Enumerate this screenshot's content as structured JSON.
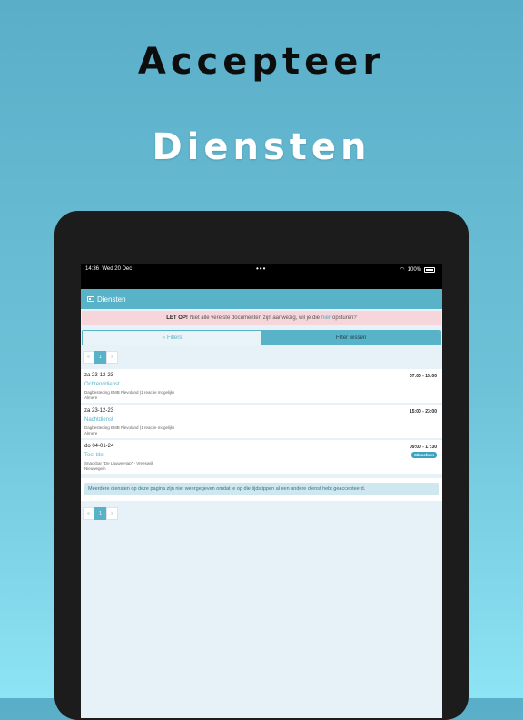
{
  "hero": {
    "line1": "Accepteer",
    "line2": "Diensten"
  },
  "status_bar": {
    "time": "14:36",
    "date": "Wed 20 Dec",
    "dots": "•••",
    "battery": "100%"
  },
  "nav": {
    "title": "Diensten",
    "icon": "id-card-icon"
  },
  "alert": {
    "strong": "LET OP!",
    "text": "Niet alle vereiste documenten zijn aanwezig, wil je die",
    "link": "hier",
    "suffix": "opsturen?"
  },
  "filters": {
    "filter_label": "Filters",
    "filter_icon": "double-chevron-down-icon",
    "clear_label": "Filter wissen"
  },
  "pagination": {
    "prev": "«",
    "page": "1",
    "next": "»"
  },
  "shifts": [
    {
      "date": "za 23-12-23",
      "time": "07:00 - 15:00",
      "title": "Ochtenddienst",
      "org": "Dagbesteding EMB Flevoland (1 reactie mogelijk)",
      "location": "Almere"
    },
    {
      "date": "za 23-12-23",
      "time": "15:00 - 23:00",
      "title": "Nachtdienst",
      "org": "Dagbesteding EMB Flevoland (1 reactie mogelijk)",
      "location": "Almere"
    },
    {
      "date": "do 04-01-24",
      "time": "09:00 - 17:30",
      "title": "Test titel",
      "org": "Snackbar \"De Lauwe Hap\" - Vreeswijk",
      "location": "Nieuwegein",
      "badge": "Misschien"
    }
  ],
  "info": "Meerdere diensten op deze pagina zijn niet weergegeven omdat je op die tijdstippen al een andere dienst hebt geaccepteerd.",
  "colors": {
    "accent": "#58b2c8",
    "alert_bg": "#f6d6db",
    "badge": "#3aa3bd"
  }
}
